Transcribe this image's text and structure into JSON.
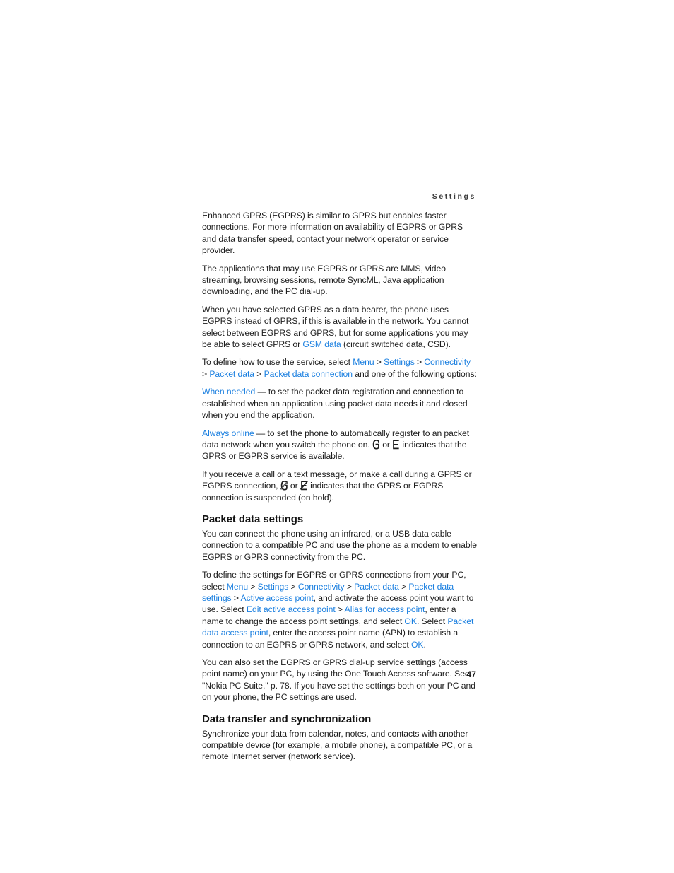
{
  "page": {
    "running_head": "Settings",
    "folio": "47",
    "link_color": "#1a7fe0",
    "text_color": "#1c1c1c",
    "background": "#ffffff"
  },
  "paragraphs": {
    "p1": "Enhanced GPRS (EGPRS) is similar to GPRS but enables faster connections. For more information on availability of EGPRS or GPRS and data transfer speed, contact your network operator or service provider.",
    "p2": "The applications that may use EGPRS or GPRS are MMS, video streaming, browsing sessions, remote SyncML, Java application downloading, and the PC dial-up.",
    "p3_a": "When you have selected GPRS as a data bearer, the phone uses EGPRS instead of GPRS, if this is available in the network. You cannot select between EGPRS and GPRS, but for some applications you may be able to select GPRS or ",
    "p3_link": "GSM data",
    "p3_b": " (circuit switched data, CSD).",
    "p4_a": "To define how to use the service, select ",
    "p4_link1": "Menu",
    "p4_sep1": " > ",
    "p4_link2": "Settings",
    "p4_sep2": " > ",
    "p4_link3": "Connectivity",
    "p4_sep3": " > ",
    "p4_link4": "Packet data",
    "p4_sep4": " > ",
    "p4_link5": "Packet data connection",
    "p4_b": " and one of the following options:",
    "p5_link": "When needed",
    "p5_text": " — to set the packet data registration and connection to established when an application using packet data needs it and closed when you end the application.",
    "p6_link": "Always online",
    "p6_a": " — to set the phone to automatically register to an packet data network when you switch the phone on. ",
    "p6_or": " or ",
    "p6_b": " indicates that the GPRS or EGPRS service is available.",
    "p7_a": "If you receive a call or a text message, or make a call during a GPRS or EGPRS connection, ",
    "p7_or": " or ",
    "p7_b": " indicates that the GPRS or EGPRS connection is suspended (on hold).",
    "h1": "Packet data settings",
    "p8": "You can connect the phone using an infrared, or a USB data cable connection to a compatible PC and use the phone as a modem to enable EGPRS or GPRS connectivity from the PC.",
    "p9_a": "To define the settings for EGPRS or GPRS connections from your PC, select ",
    "p9_link1": "Menu",
    "p9_sep1": " > ",
    "p9_link2": "Settings",
    "p9_sep2": " > ",
    "p9_link3": "Connectivity",
    "p9_sep3": " > ",
    "p9_link4": "Packet data",
    "p9_sep4": " > ",
    "p9_link5": "Packet data settings",
    "p9_sep5": " > ",
    "p9_link6": "Active access point",
    "p9_b": ", and activate the access point you want to use. Select ",
    "p9_link7": "Edit active access point",
    "p9_sep6": " > ",
    "p9_link8": "Alias for access point",
    "p9_c": ", enter a name to change the access point settings, and select ",
    "p9_link9": "OK",
    "p9_d": ". Select ",
    "p9_link10": "Packet data access point",
    "p9_e": ", enter the access point name (APN) to establish a connection to an EGPRS or GPRS network, and select ",
    "p9_link11": "OK",
    "p9_f": ".",
    "p10": "You can also set the EGPRS or GPRS dial-up service settings (access point name) on your PC, by using the One Touch Access software. See \"Nokia PC Suite,\" p. 78. If you have set the settings both on your PC and on your phone, the PC settings are used.",
    "h2": "Data transfer and synchronization",
    "p11": "Synchronize your data from calendar, notes, and contacts with another compatible device (for example, a mobile phone), a compatible PC, or a remote Internet server (network service)."
  },
  "icons": {
    "gprs_available": "gprs-g-icon",
    "egprs_available": "egprs-e-icon",
    "gprs_suspended": "gprs-suspended-icon",
    "egprs_suspended": "egprs-suspended-icon"
  }
}
